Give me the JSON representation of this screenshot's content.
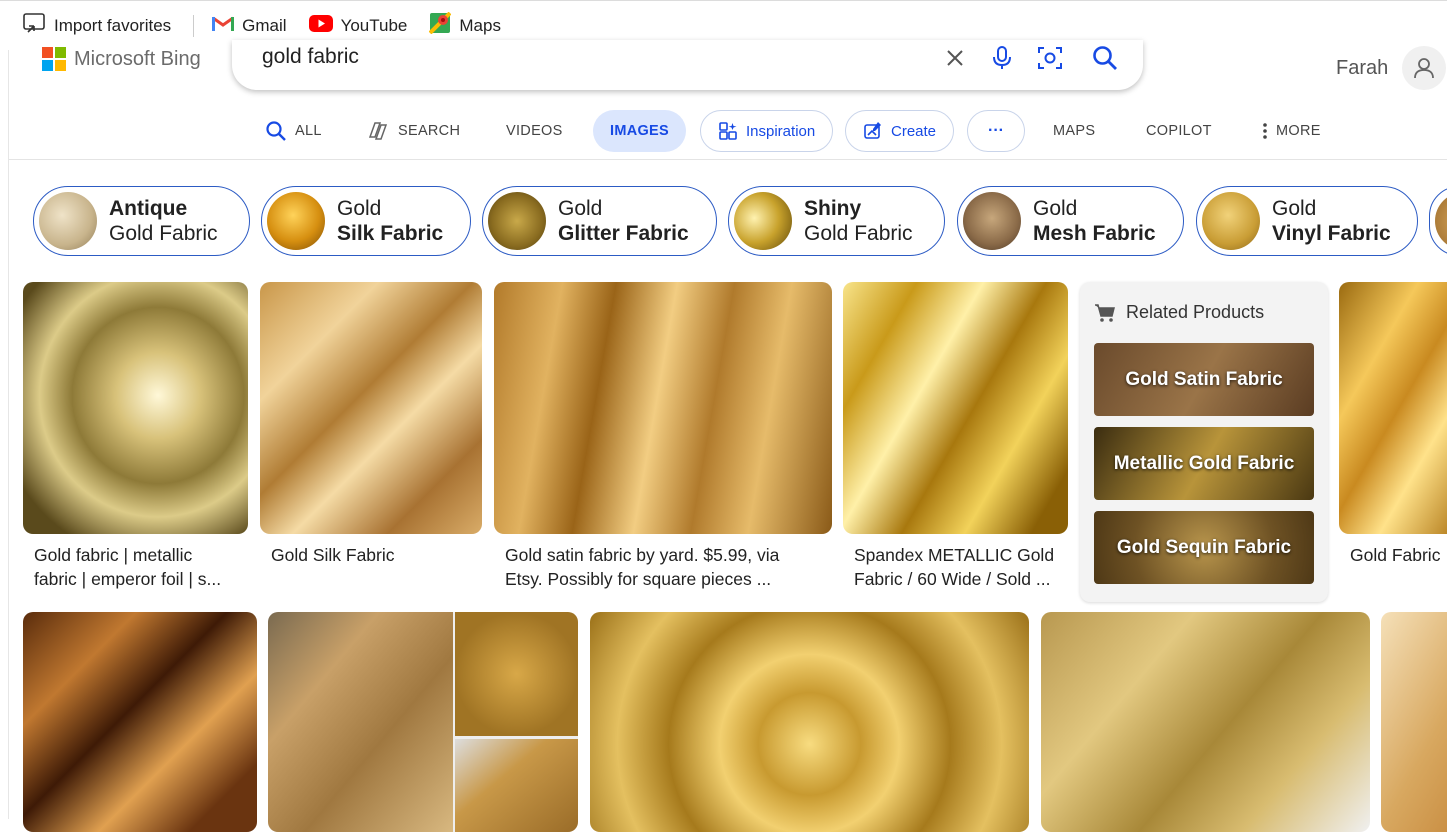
{
  "favorites": [
    {
      "label": "Import favorites",
      "icon": "import-favorites-icon"
    },
    {
      "label": "Gmail",
      "icon": "gmail-icon"
    },
    {
      "label": "YouTube",
      "icon": "youtube-icon"
    },
    {
      "label": "Maps",
      "icon": "maps-icon"
    }
  ],
  "brand": {
    "name": "Microsoft Bing"
  },
  "search": {
    "query": "gold fabric"
  },
  "user": {
    "name": "Farah"
  },
  "nav": {
    "all": "ALL",
    "search": "SEARCH",
    "videos": "VIDEOS",
    "images": "IMAGES",
    "inspiration": "Inspiration",
    "create": "Create",
    "more_dots": "···",
    "maps": "MAPS",
    "copilot": "COPILOT",
    "more": "MORE"
  },
  "chips": [
    {
      "bold": "Antique",
      "normal": "Gold Fabric"
    },
    {
      "normal": "Gold",
      "bold": "Silk Fabric"
    },
    {
      "normal": "Gold",
      "bold": "Glitter Fabric"
    },
    {
      "bold": "Shiny",
      "normal": "Gold Fabric"
    },
    {
      "normal": "Gold",
      "bold": "Mesh Fabric"
    },
    {
      "normal": "Gold",
      "bold": "Vinyl Fabric"
    }
  ],
  "results": [
    {
      "line1": "Gold fabric | metallic",
      "line2": "fabric | emperor foil | s..."
    },
    {
      "line1": "Gold Silk Fabric",
      "line2": ""
    },
    {
      "line1": "Gold satin fabric by yard. $5.99, via",
      "line2": "Etsy. Possibly for square pieces ..."
    },
    {
      "line1": "Spandex METALLIC Gold",
      "line2": "Fabric / 60 Wide / Sold ..."
    },
    {
      "line1": "Gold Fabric",
      "line2": ""
    }
  ],
  "related": {
    "title": "Related Products",
    "items": [
      "Gold Satin Fabric",
      "Metallic Gold Fabric",
      "Gold Sequin Fabric"
    ]
  },
  "colors": {
    "accent": "#174ae4",
    "chip_border": "#2c5bc4",
    "active_tab_bg": "#dbe6fd"
  }
}
